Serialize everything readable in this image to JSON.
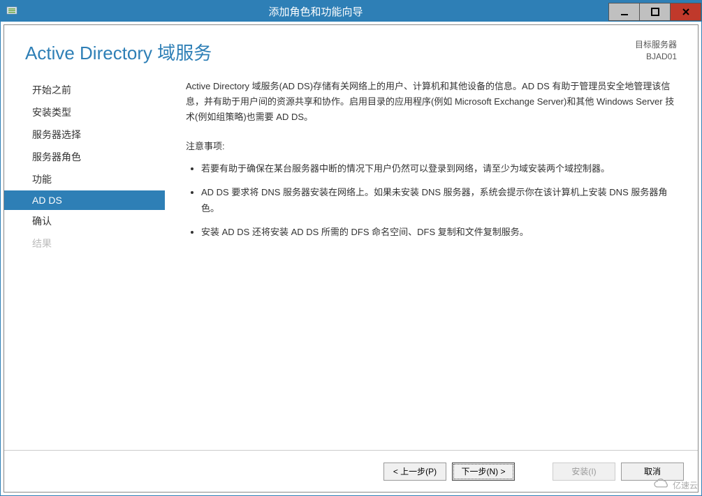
{
  "window": {
    "title": "添加角色和功能向导"
  },
  "header": {
    "page_title": "Active Directory 域服务",
    "target_label": "目标服务器",
    "target_server": "BJAD01"
  },
  "sidebar": {
    "items": [
      {
        "label": "开始之前",
        "state": "normal"
      },
      {
        "label": "安装类型",
        "state": "normal"
      },
      {
        "label": "服务器选择",
        "state": "normal"
      },
      {
        "label": "服务器角色",
        "state": "normal"
      },
      {
        "label": "功能",
        "state": "normal"
      },
      {
        "label": "AD DS",
        "state": "selected"
      },
      {
        "label": "确认",
        "state": "normal"
      },
      {
        "label": "结果",
        "state": "disabled"
      }
    ]
  },
  "main": {
    "intro": "Active Directory 域服务(AD DS)存储有关网络上的用户、计算机和其他设备的信息。AD DS 有助于管理员安全地管理该信息，并有助于用户间的资源共享和协作。启用目录的应用程序(例如 Microsoft Exchange Server)和其他 Windows Server 技术(例如组策略)也需要 AD DS。",
    "notes_heading": "注意事项:",
    "notes": [
      "若要有助于确保在某台服务器中断的情况下用户仍然可以登录到网络，请至少为域安装两个域控制器。",
      "AD DS 要求将 DNS 服务器安装在网络上。如果未安装 DNS 服务器，系统会提示你在该计算机上安装 DNS 服务器角色。",
      "安装 AD DS 还将安装 AD DS 所需的 DFS 命名空间、DFS 复制和文件复制服务。"
    ]
  },
  "footer": {
    "previous": "< 上一步(P)",
    "next": "下一步(N) >",
    "install": "安装(I)",
    "cancel": "取消"
  },
  "watermark": {
    "text": "亿速云"
  }
}
